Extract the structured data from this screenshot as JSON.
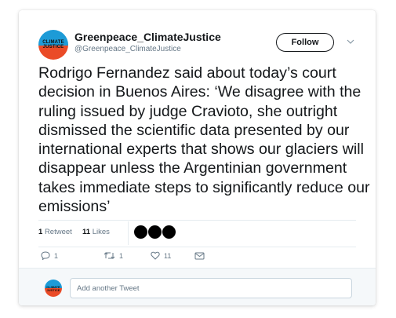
{
  "header": {
    "display_name": "Greenpeace_ClimateJustice",
    "handle": "@Greenpeace_ClimateJustice",
    "avatar_text": "CLIMATE JUSTICE",
    "follow_label": "Follow"
  },
  "tweet": {
    "text": "Rodrigo Fernandez said about today’s court decision in Buenos Aires: ‘We disagree with the ruling issued by judge Cravioto, she outright dismissed the scientific data presented by our international experts that shows our glaciers will disappear unless the Argentinian government takes immediate steps to significantly reduce our emissions’"
  },
  "stats": {
    "retweet_count": "1",
    "retweet_label": "Retweet",
    "like_count": "11",
    "like_label": "Likes"
  },
  "actions": {
    "reply_count": "1",
    "retweet_count": "1",
    "like_count": "11"
  },
  "reply": {
    "placeholder": "Add another Tweet"
  },
  "colors": {
    "brand_blue": "#1d9bd7",
    "brand_red": "#ea4b27",
    "text": "#14171a",
    "muted": "#657786"
  },
  "icons": {
    "reply": "reply-icon",
    "retweet": "retweet-icon",
    "like": "heart-icon",
    "dm": "envelope-icon",
    "more": "chevron-down-icon"
  }
}
